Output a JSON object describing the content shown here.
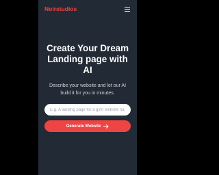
{
  "navbar": {
    "brand": "Noirstudios",
    "menu_icon": "hamburger-menu-icon"
  },
  "hero": {
    "title": "Create Your Dream Landing page with AI",
    "subtitle": "Describe your website and let our AI build it for you in minutes."
  },
  "form": {
    "input_placeholder": "E.g. A landing page for a gym website na",
    "input_value": "",
    "button_label": "Generate Website",
    "button_icon": "arrow-right-icon"
  },
  "colors": {
    "background": "#000000",
    "surface": "#222a35",
    "accent": "#ef4444",
    "title": "#ffffff",
    "subtitle": "#d1d5db",
    "input_background": "#ffffff",
    "placeholder": "#9ca3af"
  }
}
